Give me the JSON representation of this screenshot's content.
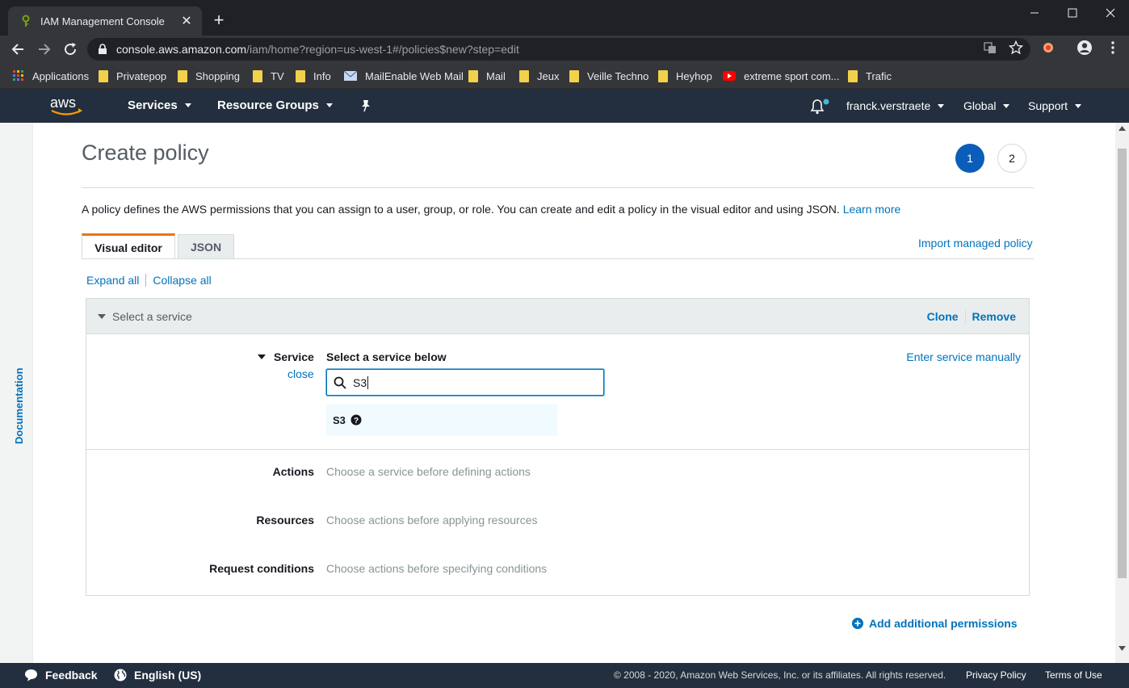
{
  "browser": {
    "tab_title": "IAM Management Console",
    "url_host": "console.aws.amazon.com",
    "url_path": "/iam/home?region=us-west-1#/policies$new?step=edit",
    "bookmarks": [
      {
        "label": "Applications",
        "icon": "apps-grid-icon"
      },
      {
        "label": "Privatepop",
        "icon": "folder-icon"
      },
      {
        "label": "Shopping",
        "icon": "folder-icon"
      },
      {
        "label": "TV",
        "icon": "folder-icon"
      },
      {
        "label": "Info",
        "icon": "folder-icon"
      },
      {
        "label": "MailEnable Web Mail",
        "icon": "mail-icon"
      },
      {
        "label": "Mail",
        "icon": "folder-icon"
      },
      {
        "label": "Jeux",
        "icon": "folder-icon"
      },
      {
        "label": "Veille Techno",
        "icon": "folder-icon"
      },
      {
        "label": "Heyhop",
        "icon": "folder-icon"
      },
      {
        "label": "extreme sport com...",
        "icon": "youtube-icon"
      },
      {
        "label": "Trafic",
        "icon": "folder-icon"
      }
    ]
  },
  "aws_header": {
    "logo_text": "aws",
    "services": "Services",
    "resource_groups": "Resource Groups",
    "user": "franck.verstraete",
    "region": "Global",
    "support": "Support"
  },
  "sidebar": {
    "documentation": "Documentation"
  },
  "page": {
    "title": "Create policy",
    "steps": [
      "1",
      "2"
    ],
    "active_step": "1",
    "description": "A policy defines the AWS permissions that you can assign to a user, group, or role. You can create and edit a policy in the visual editor and using JSON.",
    "learn_more": "Learn more",
    "tabs": {
      "visual_editor": "Visual editor",
      "json": "JSON"
    },
    "import_managed_policy": "Import managed policy",
    "expand_all": "Expand all",
    "collapse_all": "Collapse all"
  },
  "permission_block": {
    "header": "Select a service",
    "clone": "Clone",
    "remove": "Remove",
    "service": {
      "label": "Service",
      "close": "close",
      "heading": "Select a service below",
      "enter_manually": "Enter service manually",
      "search_value": "S3",
      "result": "S3"
    },
    "rows": [
      {
        "label": "Actions",
        "value": "Choose a service before defining actions"
      },
      {
        "label": "Resources",
        "value": "Choose actions before applying resources"
      },
      {
        "label": "Request conditions",
        "value": "Choose actions before specifying conditions"
      }
    ],
    "add_permissions": "Add additional permissions"
  },
  "footer": {
    "feedback": "Feedback",
    "language": "English (US)",
    "copyright": "© 2008 - 2020, Amazon Web Services, Inc. or its affiliates. All rights reserved.",
    "privacy": "Privacy Policy",
    "terms": "Terms of Use"
  },
  "colors": {
    "aws_nav": "#232f3e",
    "link": "#0073bb",
    "active_tab_accent": "#ec7211",
    "step_active": "#0a5db8"
  }
}
